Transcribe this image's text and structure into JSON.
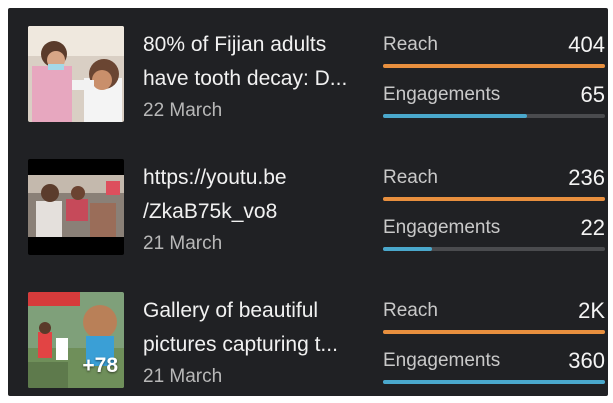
{
  "colors": {
    "reach_bar": "#e88f3e",
    "engagement_bar": "#4aa8cc",
    "track": "#4a4b4e",
    "background": "#202124"
  },
  "posts": [
    {
      "thumbnail": "post-photo-dental-check",
      "title_line1": "80% of Fijian adults",
      "title_line2": "have tooth decay: D...",
      "date": "22 March",
      "reach_label": "Reach",
      "reach_value": "404",
      "reach_fill": 1.0,
      "engagements_label": "Engagements",
      "engagements_value": "65",
      "engagements_fill": 0.65
    },
    {
      "thumbnail": "post-video-thumbnail",
      "title_line1": "https://youtu.be",
      "title_line2": "/ZkaB75k_vo8",
      "date": "21 March",
      "reach_label": "Reach",
      "reach_value": "236",
      "reach_fill": 1.0,
      "engagements_label": "Engagements",
      "engagements_value": "22",
      "engagements_fill": 0.22
    },
    {
      "thumbnail": "post-gallery-thumbnail",
      "title_line1": "Gallery of beautiful",
      "title_line2": "pictures capturing t...",
      "date": "21 March",
      "extra_photos": "+78",
      "reach_label": "Reach",
      "reach_value": "2K",
      "reach_fill": 1.0,
      "engagements_label": "Engagements",
      "engagements_value": "360",
      "engagements_fill": 1.0
    }
  ]
}
